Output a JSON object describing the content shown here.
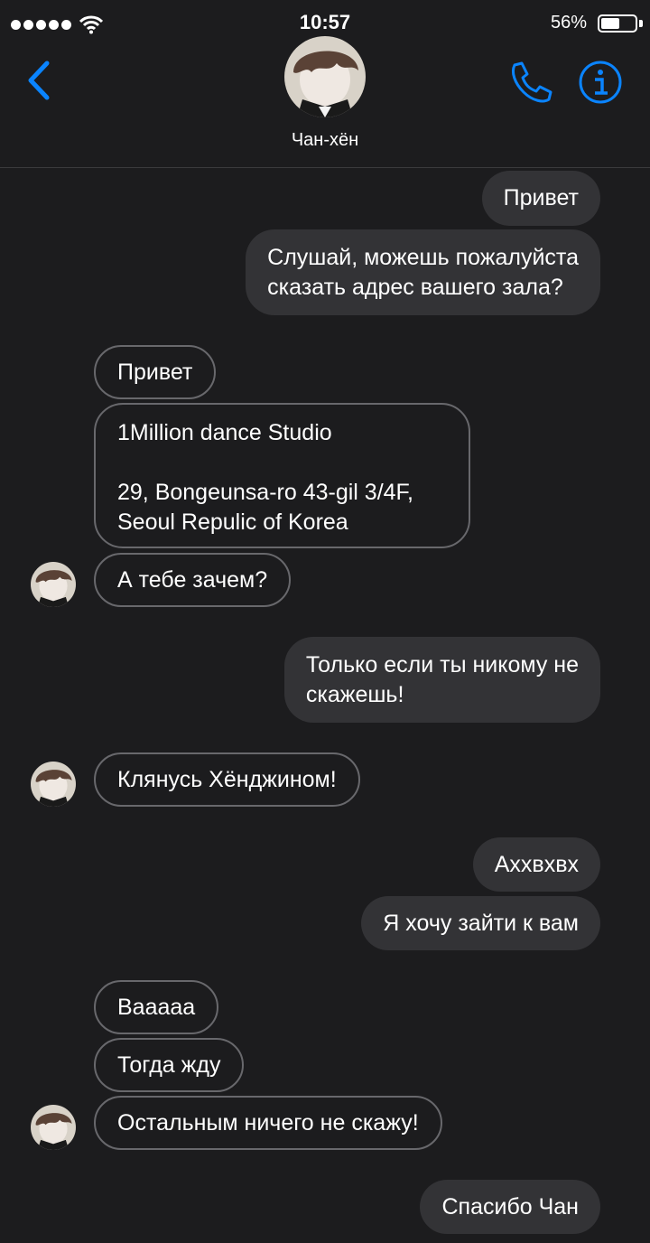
{
  "status_bar": {
    "time": "10:57",
    "battery_percent": "56%",
    "battery_level": 0.56
  },
  "header": {
    "contact_name": "Чан-хён",
    "back_icon": "chevron-left-icon",
    "call_icon": "phone-icon",
    "info_icon": "info-icon",
    "accent_color": "#0a84ff"
  },
  "messages": [
    {
      "side": "sent",
      "lines": [
        "Привет"
      ]
    },
    {
      "side": "sent",
      "lines": [
        "Слушай, можешь пожалуйста",
        "сказать адрес вашего зала?"
      ]
    },
    {
      "side": "received",
      "lines": [
        "Привет"
      ]
    },
    {
      "side": "received",
      "lines": [
        "1Million dance Studio",
        "",
        "29, Bongeunsa-ro 43-gil 3/4F,",
        "Seoul Repulic of Korea"
      ]
    },
    {
      "side": "received",
      "lines": [
        "А тебе зачем?"
      ]
    },
    {
      "side": "sent",
      "lines": [
        "Только если ты никому не",
        "скажешь!"
      ]
    },
    {
      "side": "received",
      "lines": [
        "Клянусь Хёнджином!"
      ]
    },
    {
      "side": "sent",
      "lines": [
        "Аххвхвх"
      ]
    },
    {
      "side": "sent",
      "lines": [
        "Я хочу зайти к вам"
      ]
    },
    {
      "side": "received",
      "lines": [
        "Вааааа"
      ]
    },
    {
      "side": "received",
      "lines": [
        "Тогда жду"
      ]
    },
    {
      "side": "received",
      "lines": [
        "Остальным ничего не скажу!"
      ]
    },
    {
      "side": "sent",
      "lines": [
        "Спасибо Чан"
      ]
    }
  ]
}
